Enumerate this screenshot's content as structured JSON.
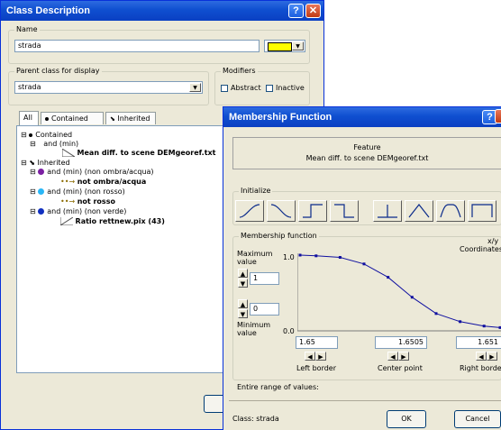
{
  "class_description": {
    "title": "Class Description",
    "name_group": "Name",
    "name_value": "strada",
    "color": "#ffff00",
    "parent_group": "Parent class for display",
    "parent_value": "strada",
    "modifiers_group": "Modifiers",
    "abstract_label": "Abstract",
    "inactive_label": "Inactive",
    "tabs": [
      "All",
      "Contained",
      "Inherited"
    ],
    "tree": {
      "contained": "Contained",
      "and_min": "and (min)",
      "mean_diff": "Mean diff. to scene DEMgeoref.txt",
      "inherited": "Inherited",
      "and_non_ombra": "and (min) (non ombra/acqua)",
      "not_ombra": "not ombra/acqua",
      "and_non_rosso": "and (min) (non rosso)",
      "not_rosso": "not rosso",
      "and_non_verde": "and (min) (non verde)",
      "ratio": "Ratio rettnew.pix (43)"
    }
  },
  "membership": {
    "title": "Membership Function",
    "feature_label": "Feature",
    "feature_value": "Mean diff. to scene DEMgeoref.txt",
    "initialize_group": "Initialize",
    "mf_group": "Membership function",
    "xy_label": "x/y",
    "coordinates_label": "Coordinates",
    "max_label_1": "Maximum",
    "max_label_2": "value",
    "max_value": "1",
    "min_value": "0",
    "min_label_1": "Minimum",
    "min_label_2": "value",
    "y_top": "1.0",
    "y_bottom": "0.0",
    "left_border_value": "1.65",
    "center_point_value": "1.6505",
    "right_border_value": "1.651",
    "left_border_label": "Left border",
    "center_point_label": "Center point",
    "right_border_label": "Right border",
    "range_label": "Entire range of values:",
    "class_label": "Class: strada",
    "ok_label": "OK",
    "cancel_label": "Cancel",
    "curve_points": [
      [
        0.0,
        1.0
      ],
      [
        0.08,
        0.99
      ],
      [
        0.2,
        0.97
      ],
      [
        0.32,
        0.88
      ],
      [
        0.44,
        0.7
      ],
      [
        0.56,
        0.43
      ],
      [
        0.68,
        0.21
      ],
      [
        0.8,
        0.1
      ],
      [
        0.92,
        0.04
      ],
      [
        1.0,
        0.02
      ]
    ]
  },
  "colors": {
    "contained_dot": "#000000",
    "ombra_dot": "#7b1fa2",
    "rosso_dot": "#29b6f6",
    "verde_dot": "#1030c0",
    "curve": "#1010a0"
  }
}
